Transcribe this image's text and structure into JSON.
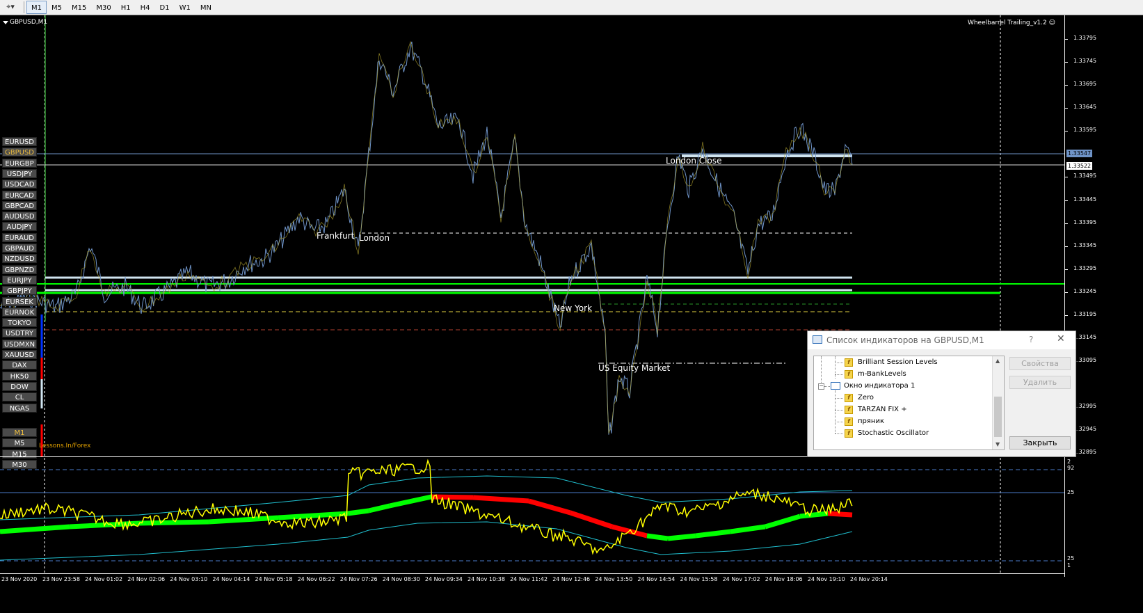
{
  "toolbar": {
    "timeframes": [
      "M1",
      "M5",
      "M15",
      "M30",
      "H1",
      "H4",
      "D1",
      "W1",
      "MN"
    ],
    "active": "M1"
  },
  "chart": {
    "symbol": "GBPUSD,M1",
    "ea": "Wheelbarrel Trailing_v1.2 ☺",
    "price_labels": [
      "1.33795",
      "1.33745",
      "1.33695",
      "1.33645",
      "1.33595",
      "1.33495",
      "1.33445",
      "1.33395",
      "1.33345",
      "1.33295",
      "1.33245",
      "1.33195",
      "1.33145",
      "1.33095",
      "1.32995",
      "1.32945",
      "1.32895"
    ],
    "bid_tag": "1.33547",
    "ask_tag": "1.33522",
    "sessions": [
      "Frankfurt",
      "London",
      "London Close",
      "New York",
      "US Equity Market"
    ],
    "watermark": "Lessons.In/Forex",
    "symbol_buttons": [
      "EURUSD",
      "GBPUSD",
      "EURGBP",
      "USDJPY",
      "USDCAD",
      "EURCAD",
      "GBPCAD",
      "AUDUSD",
      "AUDJPY",
      "EURAUD",
      "GBPAUD",
      "NZDUSD",
      "GBPNZD",
      "EURJPY",
      "GBPJPY",
      "EURSEK",
      "EURNOK",
      "TOKYO",
      "USDTRY",
      "USDMXN",
      "XAUUSD",
      "DAX",
      "HK50",
      "DOW",
      "CL",
      "NGAS"
    ],
    "selected_symbol": "GBPUSD",
    "timeframe_buttons": [
      "M1",
      "M5",
      "M15",
      "M30"
    ],
    "selected_timeframe": "M1"
  },
  "subwindow": {
    "levels": [
      "2",
      "92",
      "25",
      "25",
      "1"
    ]
  },
  "time_axis": [
    "23 Nov 2020",
    "23 Nov 23:58",
    "24 Nov 01:02",
    "24 Nov 02:06",
    "24 Nov 03:10",
    "24 Nov 04:14",
    "24 Nov 05:18",
    "24 Nov 06:22",
    "24 Nov 07:26",
    "24 Nov 08:30",
    "24 Nov 09:34",
    "24 Nov 10:38",
    "24 Nov 11:42",
    "24 Nov 12:46",
    "24 Nov 13:50",
    "24 Nov 14:54",
    "24 Nov 15:58",
    "24 Nov 17:02",
    "24 Nov 18:06",
    "24 Nov 19:10",
    "24 Nov 20:14"
  ],
  "dialog": {
    "title": "Список индикаторов на GBPUSD,M1",
    "help": "?",
    "close_x": "✕",
    "items": [
      "Brilliant Session Levels",
      "m-BankLevels",
      "Окно индикатора 1",
      "Zero",
      "TARZAN FIX +",
      "пряник",
      "Stochastic Oscillator"
    ],
    "buttons": {
      "properties": "Свойства",
      "delete": "Удалить",
      "close": "Закрыть"
    }
  },
  "colors": {
    "bg": "#000000",
    "price_line": "#6f94c8",
    "green": "#00ff00",
    "red": "#ff0000",
    "yellow": "#ffff00",
    "cyan": "#20c0d0"
  }
}
